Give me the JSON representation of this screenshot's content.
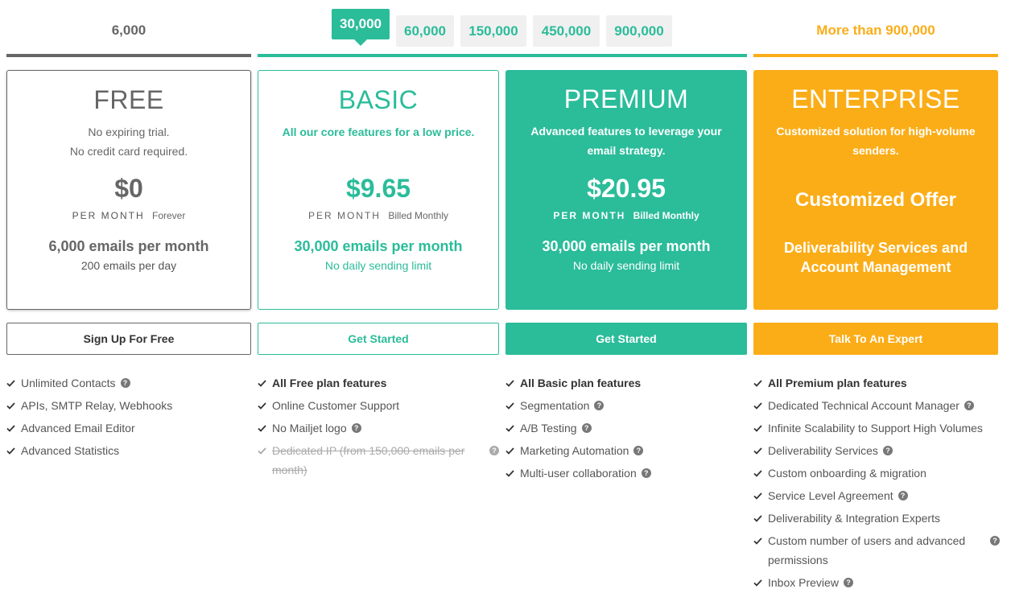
{
  "volume_selector": {
    "free_label": "6,000",
    "tabs": [
      {
        "label": "30,000",
        "active": true
      },
      {
        "label": "60,000",
        "active": false
      },
      {
        "label": "150,000",
        "active": false
      },
      {
        "label": "450,000",
        "active": false
      },
      {
        "label": "900,000",
        "active": false
      }
    ],
    "enterprise_label": "More than 900,000"
  },
  "colors": {
    "free": "#666666",
    "accent": "#2bbc9a",
    "enterprise": "#fbad18"
  },
  "plans": {
    "free": {
      "name": "FREE",
      "desc_line1": "No expiring trial.",
      "desc_line2": "No credit card required.",
      "price": "$0",
      "per_month": "PER MONTH",
      "billing": "Forever",
      "emails": "6,000 emails per month",
      "daily": "200 emails per day",
      "cta": "Sign Up For Free"
    },
    "basic": {
      "name": "BASIC",
      "desc": "All our core features for a low price.",
      "price": "$9.65",
      "per_month": "PER MONTH",
      "billing": "Billed Monthly",
      "emails": "30,000 emails per month",
      "daily": "No daily sending limit",
      "cta": "Get Started"
    },
    "premium": {
      "name": "PREMIUM",
      "desc": "Advanced features to leverage your email strategy.",
      "price": "$20.95",
      "per_month": "PER MONTH",
      "billing": "Billed Monthly",
      "emails": "30,000 emails per month",
      "daily": "No daily sending limit",
      "cta": "Get Started"
    },
    "enterprise": {
      "name": "ENTERPRISE",
      "desc": "Customized solution for high-volume senders.",
      "offer": "Customized Offer",
      "services": "Deliverability Services and Account Management",
      "cta": "Talk To An Expert"
    }
  },
  "features": {
    "free": [
      {
        "text": "Unlimited Contacts",
        "help": "?"
      },
      {
        "text": "APIs, SMTP Relay, Webhooks"
      },
      {
        "text": "Advanced Email Editor"
      },
      {
        "text": "Advanced Statistics"
      }
    ],
    "basic": [
      {
        "text": "All Free plan features"
      },
      {
        "text": "Online Customer Support"
      },
      {
        "text": "No Mailjet logo",
        "help": "?"
      },
      {
        "text": "Dedicated IP (from 150,000 emails per month)",
        "help": "?"
      }
    ],
    "premium": [
      {
        "text": "All Basic plan features"
      },
      {
        "text": "Segmentation",
        "help": "?"
      },
      {
        "text": "A/B Testing",
        "help": "?"
      },
      {
        "text": "Marketing Automation",
        "help": "?"
      },
      {
        "text": "Multi-user collaboration",
        "help": "?"
      }
    ],
    "enterprise": [
      {
        "text": "All Premium plan features"
      },
      {
        "text": "Dedicated Technical Account Manager",
        "help": "?"
      },
      {
        "text": "Infinite Scalability to Support High Volumes"
      },
      {
        "text": "Deliverability Services",
        "help": "?"
      },
      {
        "text": "Custom onboarding & migration"
      },
      {
        "text": "Service Level Agreement",
        "help": "?"
      },
      {
        "text": "Deliverability & Integration Experts"
      },
      {
        "text": "Custom number of users and advanced permissions",
        "help": "?"
      },
      {
        "text": "Inbox Preview",
        "help": "?"
      }
    ]
  }
}
